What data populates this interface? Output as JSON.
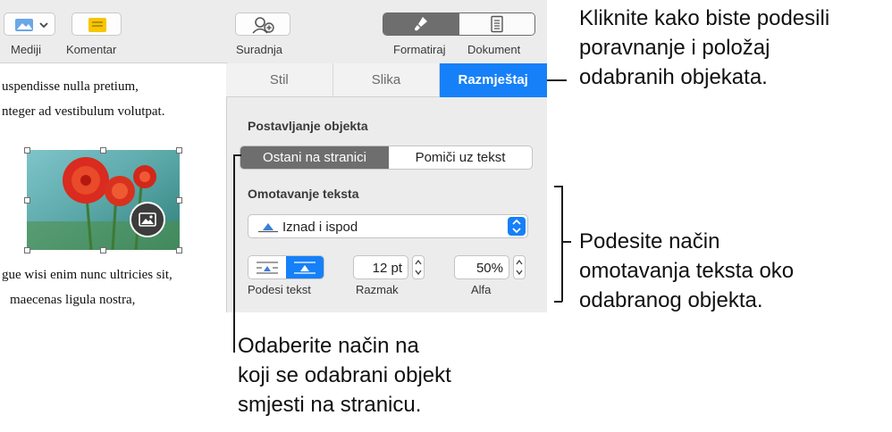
{
  "toolbar": {
    "media_label": "Mediji",
    "comment_label": "Komentar",
    "collaborate_label": "Suradnja",
    "format_label": "Formatiraj",
    "document_label": "Dokument"
  },
  "document": {
    "lines_top": [
      "uspendisse nulla pretium,",
      "nteger ad vestibulum volutpat."
    ],
    "lines_bottom": [
      "gue wisi enim nunc ultricies sit,",
      "maecenas ligula nostra,"
    ]
  },
  "inspector": {
    "tabs": [
      {
        "label": "Stil",
        "active": false
      },
      {
        "label": "Slika",
        "active": false
      },
      {
        "label": "Razmještaj",
        "active": true
      }
    ],
    "object_placement": {
      "title": "Postavljanje objekta",
      "options": [
        "Ostani na stranici",
        "Pomiči uz tekst"
      ],
      "selected": "Ostani na stranici"
    },
    "text_wrap": {
      "title": "Omotavanje teksta",
      "selected": "Iznad i ispod",
      "fit_label": "Podesi tekst",
      "spacing_value": "12 pt",
      "spacing_label": "Razmak",
      "alpha_value": "50%",
      "alpha_label": "Alfa"
    }
  },
  "callouts": {
    "top": [
      "Kliknite kako biste podesili",
      "poravnanje i položaj",
      "odabranih objekata."
    ],
    "middle": [
      "Podesite način",
      "omotavanja teksta oko",
      "odabranog objekta."
    ],
    "bottom": [
      "Odaberite način na",
      "koji se odabrani objekt",
      "smjesti na stranicu."
    ]
  },
  "colors": {
    "accent": "#1680f8",
    "selected_segment": "#6e6e6e"
  }
}
